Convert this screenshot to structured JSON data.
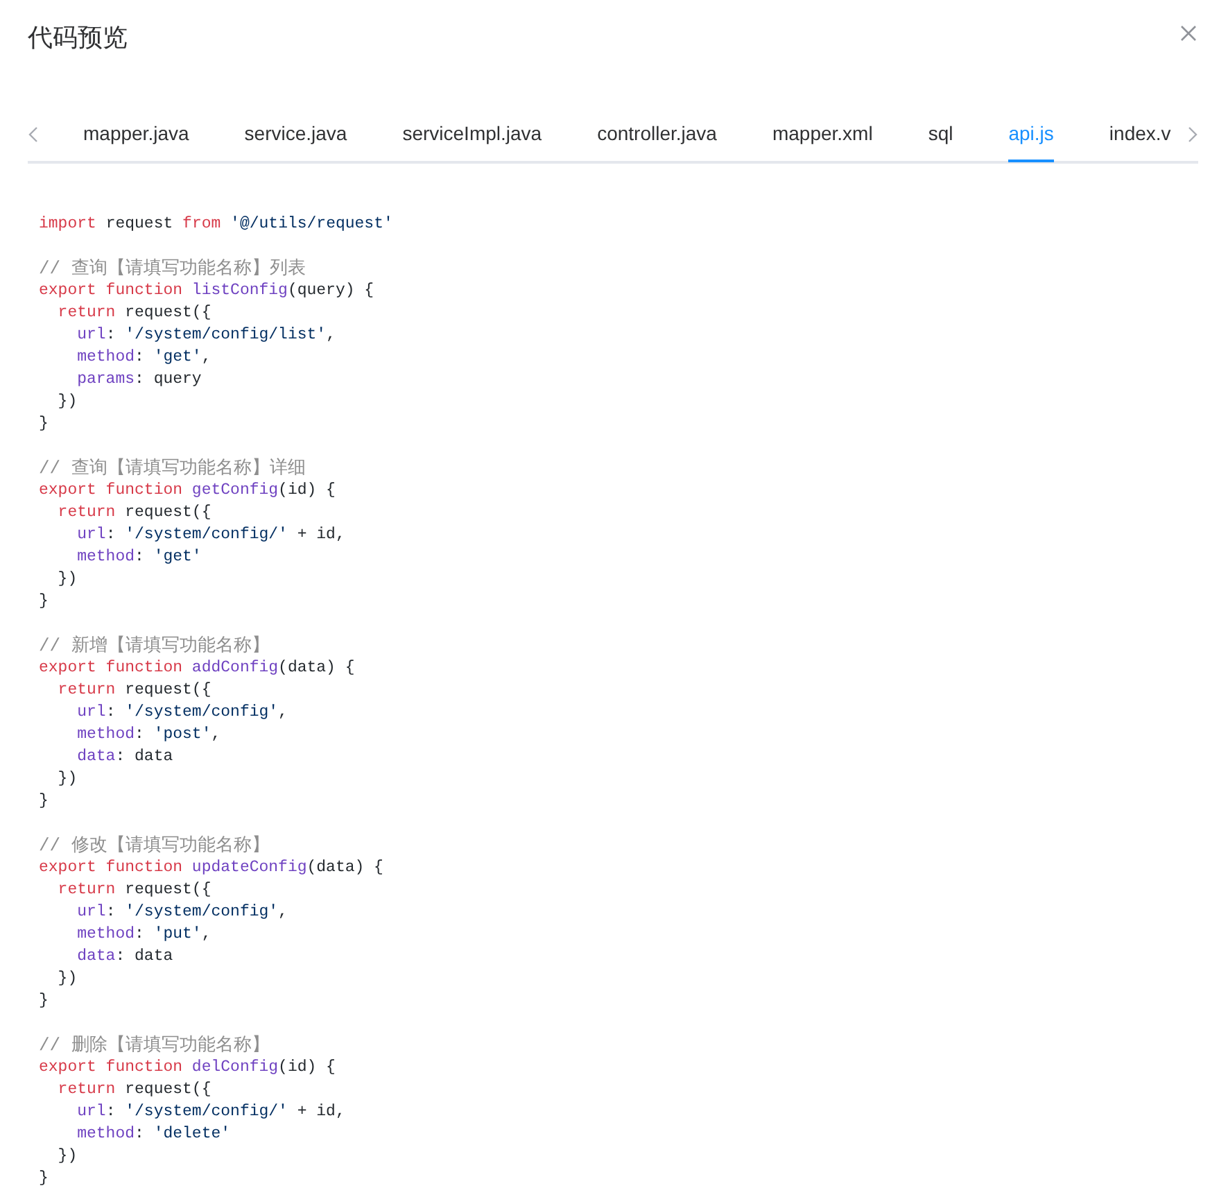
{
  "dialog": {
    "title": "代码预览"
  },
  "tabs": [
    {
      "label": "mapper.java",
      "selected": false
    },
    {
      "label": "service.java",
      "selected": false
    },
    {
      "label": "serviceImpl.java",
      "selected": false
    },
    {
      "label": "controller.java",
      "selected": false
    },
    {
      "label": "mapper.xml",
      "selected": false
    },
    {
      "label": "sql",
      "selected": false
    },
    {
      "label": "api.js",
      "selected": true
    },
    {
      "label": "index.v",
      "selected": false
    }
  ],
  "code": {
    "blocks": [
      {
        "lines": [
          [
            {
              "kind": "keyword",
              "text": "import"
            },
            {
              "kind": "plain",
              "text": " request "
            },
            {
              "kind": "keyword",
              "text": "from"
            },
            {
              "kind": "string",
              "text": " '@/utils/request'"
            }
          ]
        ]
      },
      {
        "lines": [
          [
            {
              "kind": "comment",
              "text": "// 查询【请填写功能名称】列表"
            }
          ],
          [
            {
              "kind": "keyword",
              "text": "export function"
            },
            {
              "kind": "title",
              "text": " listConfig"
            },
            {
              "kind": "plain",
              "text": "(query) {"
            }
          ],
          [
            {
              "kind": "keyword",
              "text": "  return"
            },
            {
              "kind": "plain",
              "text": " request({"
            }
          ],
          [
            {
              "kind": "attr",
              "text": "    url"
            },
            {
              "kind": "plain",
              "text": ": "
            },
            {
              "kind": "string",
              "text": "'/system/config/list'"
            },
            {
              "kind": "plain",
              "text": ","
            }
          ],
          [
            {
              "kind": "attr",
              "text": "    method"
            },
            {
              "kind": "plain",
              "text": ": "
            },
            {
              "kind": "string",
              "text": "'get'"
            },
            {
              "kind": "plain",
              "text": ","
            }
          ],
          [
            {
              "kind": "attr",
              "text": "    params"
            },
            {
              "kind": "plain",
              "text": ": query"
            }
          ],
          [
            {
              "kind": "plain",
              "text": "  })"
            }
          ],
          [
            {
              "kind": "plain",
              "text": "}"
            }
          ]
        ]
      },
      {
        "lines": [
          [
            {
              "kind": "comment",
              "text": "// 查询【请填写功能名称】详细"
            }
          ],
          [
            {
              "kind": "keyword",
              "text": "export function"
            },
            {
              "kind": "title",
              "text": " getConfig"
            },
            {
              "kind": "plain",
              "text": "(id) {"
            }
          ],
          [
            {
              "kind": "keyword",
              "text": "  return"
            },
            {
              "kind": "plain",
              "text": " request({"
            }
          ],
          [
            {
              "kind": "attr",
              "text": "    url"
            },
            {
              "kind": "plain",
              "text": ": "
            },
            {
              "kind": "string",
              "text": "'/system/config/'"
            },
            {
              "kind": "plain",
              "text": " + id,"
            }
          ],
          [
            {
              "kind": "attr",
              "text": "    method"
            },
            {
              "kind": "plain",
              "text": ": "
            },
            {
              "kind": "string",
              "text": "'get'"
            }
          ],
          [
            {
              "kind": "plain",
              "text": "  })"
            }
          ],
          [
            {
              "kind": "plain",
              "text": "}"
            }
          ]
        ]
      },
      {
        "lines": [
          [
            {
              "kind": "comment",
              "text": "// 新增【请填写功能名称】"
            }
          ],
          [
            {
              "kind": "keyword",
              "text": "export function"
            },
            {
              "kind": "title",
              "text": " addConfig"
            },
            {
              "kind": "plain",
              "text": "(data) {"
            }
          ],
          [
            {
              "kind": "keyword",
              "text": "  return"
            },
            {
              "kind": "plain",
              "text": " request({"
            }
          ],
          [
            {
              "kind": "attr",
              "text": "    url"
            },
            {
              "kind": "plain",
              "text": ": "
            },
            {
              "kind": "string",
              "text": "'/system/config'"
            },
            {
              "kind": "plain",
              "text": ","
            }
          ],
          [
            {
              "kind": "attr",
              "text": "    method"
            },
            {
              "kind": "plain",
              "text": ": "
            },
            {
              "kind": "string",
              "text": "'post'"
            },
            {
              "kind": "plain",
              "text": ","
            }
          ],
          [
            {
              "kind": "attr",
              "text": "    data"
            },
            {
              "kind": "plain",
              "text": ": data"
            }
          ],
          [
            {
              "kind": "plain",
              "text": "  })"
            }
          ],
          [
            {
              "kind": "plain",
              "text": "}"
            }
          ]
        ]
      },
      {
        "lines": [
          [
            {
              "kind": "comment",
              "text": "// 修改【请填写功能名称】"
            }
          ],
          [
            {
              "kind": "keyword",
              "text": "export function"
            },
            {
              "kind": "title",
              "text": " updateConfig"
            },
            {
              "kind": "plain",
              "text": "(data) {"
            }
          ],
          [
            {
              "kind": "keyword",
              "text": "  return"
            },
            {
              "kind": "plain",
              "text": " request({"
            }
          ],
          [
            {
              "kind": "attr",
              "text": "    url"
            },
            {
              "kind": "plain",
              "text": ": "
            },
            {
              "kind": "string",
              "text": "'/system/config'"
            },
            {
              "kind": "plain",
              "text": ","
            }
          ],
          [
            {
              "kind": "attr",
              "text": "    method"
            },
            {
              "kind": "plain",
              "text": ": "
            },
            {
              "kind": "string",
              "text": "'put'"
            },
            {
              "kind": "plain",
              "text": ","
            }
          ],
          [
            {
              "kind": "attr",
              "text": "    data"
            },
            {
              "kind": "plain",
              "text": ": data"
            }
          ],
          [
            {
              "kind": "plain",
              "text": "  })"
            }
          ],
          [
            {
              "kind": "plain",
              "text": "}"
            }
          ]
        ]
      },
      {
        "lines": [
          [
            {
              "kind": "comment",
              "text": "// 删除【请填写功能名称】"
            }
          ],
          [
            {
              "kind": "keyword",
              "text": "export function"
            },
            {
              "kind": "title",
              "text": " delConfig"
            },
            {
              "kind": "plain",
              "text": "(id) {"
            }
          ],
          [
            {
              "kind": "keyword",
              "text": "  return"
            },
            {
              "kind": "plain",
              "text": " request({"
            }
          ],
          [
            {
              "kind": "attr",
              "text": "    url"
            },
            {
              "kind": "plain",
              "text": ": "
            },
            {
              "kind": "string",
              "text": "'/system/config/'"
            },
            {
              "kind": "plain",
              "text": " + id,"
            }
          ],
          [
            {
              "kind": "attr",
              "text": "    method"
            },
            {
              "kind": "plain",
              "text": ": "
            },
            {
              "kind": "string",
              "text": "'delete'"
            }
          ],
          [
            {
              "kind": "plain",
              "text": "  })"
            }
          ],
          [
            {
              "kind": "plain",
              "text": "}"
            }
          ]
        ]
      }
    ]
  }
}
